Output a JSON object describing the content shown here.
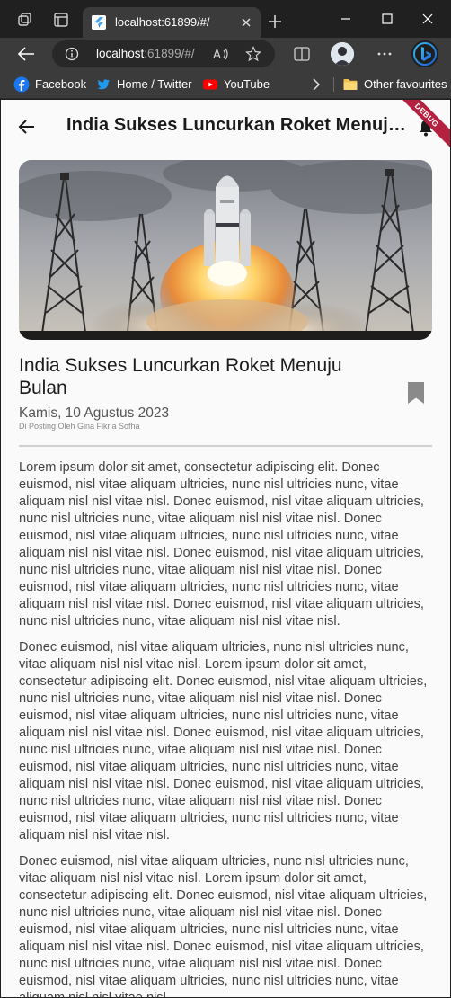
{
  "browser": {
    "tab_title": "localhost:61899/#/",
    "url_host": "localhost",
    "url_rest": ":61899/#/",
    "bookmarks": [
      {
        "label": "Facebook"
      },
      {
        "label": "Home / Twitter"
      },
      {
        "label": "YouTube"
      }
    ],
    "other_favourites": "Other favourites"
  },
  "app": {
    "appbar_title": "India Sukses Luncurkan Roket Menuju Bulan",
    "debug_banner": "DEBUG"
  },
  "article": {
    "title": "India Sukses Luncurkan Roket Menuju Bulan",
    "date": "Kamis, 10 Agustus 2023",
    "author": "Di Posting Oleh Gina Fikria Sofha",
    "paragraphs": [
      "Lorem ipsum dolor sit amet, consectetur adipiscing elit. Donec euismod, nisl vitae aliquam ultricies, nunc nisl ultricies nunc, vitae aliquam nisl nisl vitae nisl. Donec euismod, nisl vitae aliquam ultricies, nunc nisl ultricies nunc, vitae aliquam nisl nisl vitae nisl. Donec euismod, nisl vitae aliquam ultricies, nunc nisl ultricies nunc, vitae aliquam nisl nisl vitae nisl. Donec euismod, nisl vitae aliquam ultricies, nunc nisl ultricies nunc, vitae aliquam nisl nisl vitae nisl. Donec euismod, nisl vitae aliquam ultricies, nunc nisl ultricies nunc, vitae aliquam nisl nisl vitae nisl. Donec euismod, nisl vitae aliquam ultricies, nunc nisl ultricies nunc, vitae aliquam nisl nisl vitae nisl.",
      "Donec euismod, nisl vitae aliquam ultricies, nunc nisl ultricies nunc, vitae aliquam nisl nisl vitae nisl. Lorem ipsum dolor sit amet, consectetur adipiscing elit. Donec euismod, nisl vitae aliquam ultricies, nunc nisl ultricies nunc, vitae aliquam nisl nisl vitae nisl. Donec euismod, nisl vitae aliquam ultricies, nunc nisl ultricies nunc, vitae aliquam nisl nisl vitae nisl. Donec euismod, nisl vitae aliquam ultricies, nunc nisl ultricies nunc, vitae aliquam nisl nisl vitae nisl. Donec euismod, nisl vitae aliquam ultricies, nunc nisl ultricies nunc, vitae aliquam nisl nisl vitae nisl. Donec euismod, nisl vitae aliquam ultricies, nunc nisl ultricies nunc, vitae aliquam nisl nisl vitae nisl. Donec euismod, nisl vitae aliquam ultricies, nunc nisl ultricies nunc, vitae aliquam nisl nisl vitae nisl.",
      "Donec euismod, nisl vitae aliquam ultricies, nunc nisl ultricies nunc, vitae aliquam nisl nisl vitae nisl. Lorem ipsum dolor sit amet, consectetur adipiscing elit. Donec euismod, nisl vitae aliquam ultricies, nunc nisl ultricies nunc, vitae aliquam nisl nisl vitae nisl. Donec euismod, nisl vitae aliquam ultricies, nunc nisl ultricies nunc, vitae aliquam nisl nisl vitae nisl. Donec euismod, nisl vitae aliquam ultricies, nunc nisl ultricies nunc, vitae aliquam nisl nisl vitae nisl. Donec euismod, nisl vitae aliquam ultricies, nunc nisl ultricies nunc, vitae aliquam nisl nisl vitae nisl."
    ]
  },
  "icons": {
    "browser": [
      "workspaces-icon",
      "tab-actions-icon",
      "flutter-favicon",
      "close-tab-icon",
      "new-tab-icon",
      "minimize-icon",
      "maximize-icon",
      "close-window-icon",
      "back-arrow-icon",
      "site-info-icon",
      "read-aloud-icon",
      "favorite-star-icon",
      "split-screen-icon",
      "profile-avatar",
      "more-icon",
      "bing-copilot-icon",
      "facebook-icon",
      "twitter-icon",
      "youtube-icon",
      "chevron-right-icon",
      "folder-icon"
    ],
    "app": [
      "back-arrow-icon",
      "notification-bell-icon",
      "bookmark-icon"
    ]
  },
  "colors": {
    "browser_frame": "#202020",
    "browser_toolbar": "#3b3b3b",
    "page_background": "#fafafa",
    "debug_ribbon": "#b5223f",
    "bookmark_icon": "#8a8a8a"
  }
}
